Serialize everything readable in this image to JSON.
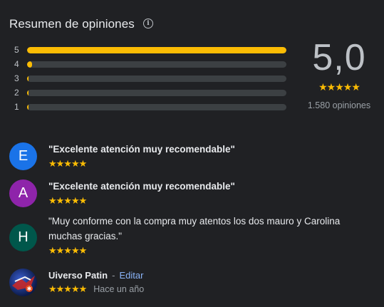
{
  "header": {
    "title": "Resumen de opiniones",
    "info_icon": "info-icon"
  },
  "distribution": [
    {
      "label": "5",
      "fraction": 1.0
    },
    {
      "label": "4",
      "fraction": 0.02
    },
    {
      "label": "3",
      "fraction": 0.005
    },
    {
      "label": "2",
      "fraction": 0.005
    },
    {
      "label": "1",
      "fraction": 0.005
    }
  ],
  "summary": {
    "score": "5,0",
    "stars": "★★★★★",
    "count": "1.580 opiniones"
  },
  "colors": {
    "star": "#fbbc04",
    "link": "#8ab4f8"
  },
  "reviews": [
    {
      "initial": "E",
      "avatar_color": "#1a73e8",
      "text": "\"Excelente atención muy recomendable\"",
      "stars": "★★★★★"
    },
    {
      "initial": "A",
      "avatar_color": "#8e24aa",
      "text": "\"Excelente atención muy recomendable\"",
      "stars": "★★★★★"
    },
    {
      "initial": "H",
      "avatar_color": "#00574b",
      "text": "\"Muy conforme con la compra muy atentos los dos mauro y Carolina muchas gracias.\"",
      "stars": "★★★★★"
    }
  ],
  "own_review": {
    "author": "Uiverso Patin",
    "separator": "-",
    "edit_label": "Editar",
    "stars": "★★★★★",
    "time": "Hace un año"
  }
}
